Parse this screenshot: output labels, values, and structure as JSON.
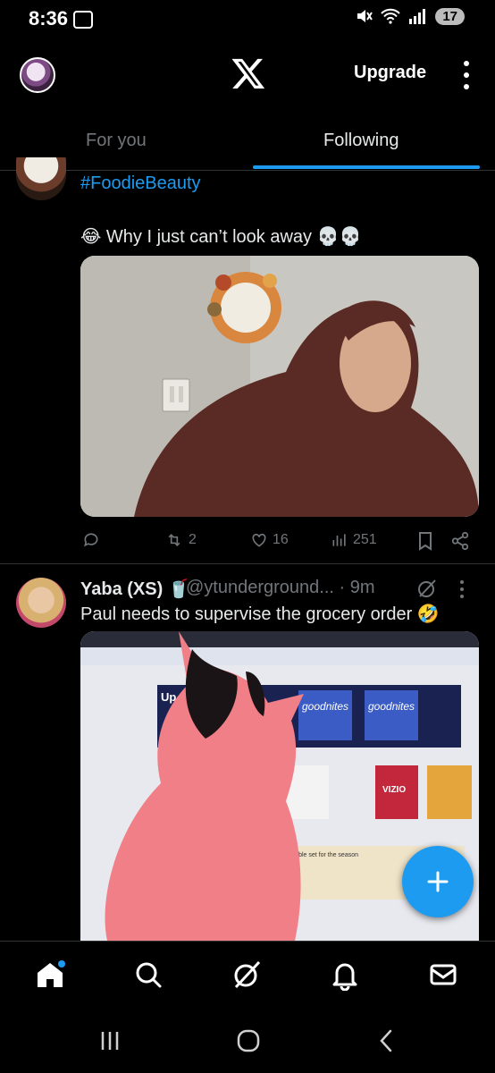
{
  "status_bar": {
    "time": "8:36",
    "battery": "17"
  },
  "header": {
    "upgrade_label": "Upgrade"
  },
  "tabs": [
    {
      "label": "For you",
      "selected": false
    },
    {
      "label": "Following",
      "selected": true
    }
  ],
  "tweet1": {
    "hashtag": "#FoodieBeauty",
    "text": "😂 Why I just can’t look away 💀💀",
    "replies": "",
    "reposts": "2",
    "likes": "16",
    "views": "251"
  },
  "tweet2": {
    "name": "Yaba (XS) 🥤",
    "handle": "@ytunderground... · 9m",
    "text": "Paul needs to supervise the grocery order 🤣",
    "screen_text": {
      "brand1": "goodnites",
      "brand2": "goodnites",
      "tv_brand": "VIZIO",
      "promo_left": "Up",
      "promo_small": "A table set for the season"
    }
  },
  "colors": {
    "accent": "#1d9bf0",
    "text_primary": "#e7e9ea",
    "text_secondary": "#71767b",
    "divider": "#2f3336"
  },
  "icons": {
    "nav": [
      "home-icon",
      "search-icon",
      "grok-icon",
      "notifications-icon",
      "messages-icon"
    ],
    "system_nav": [
      "recents-icon",
      "home-circle-icon",
      "back-icon"
    ]
  }
}
